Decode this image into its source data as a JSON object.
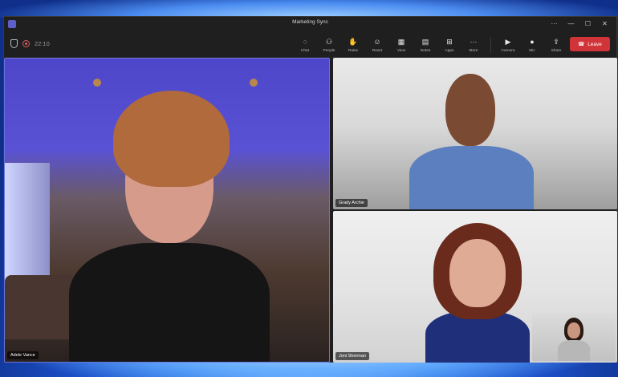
{
  "window": {
    "title": "Marketing Sync",
    "controls": [
      "···",
      "—",
      "☐",
      "✕"
    ]
  },
  "toolbar": {
    "timer": "22:10",
    "tools": [
      {
        "icon": "chat-icon",
        "glyph": "◌",
        "label": "Chat"
      },
      {
        "icon": "people-icon",
        "glyph": "⚇",
        "label": "People"
      },
      {
        "icon": "raise-hand-icon",
        "glyph": "✋",
        "label": "Raise"
      },
      {
        "icon": "react-icon",
        "glyph": "☺",
        "label": "React"
      },
      {
        "icon": "view-icon",
        "glyph": "▦",
        "label": "View"
      },
      {
        "icon": "notes-icon",
        "glyph": "▤",
        "label": "Notes"
      },
      {
        "icon": "apps-icon",
        "glyph": "⊞",
        "label": "Apps"
      },
      {
        "icon": "more-icon",
        "glyph": "···",
        "label": "More"
      }
    ],
    "media": [
      {
        "icon": "camera-icon",
        "glyph": "▶",
        "label": "Camera"
      },
      {
        "icon": "mic-icon",
        "glyph": "●",
        "label": "Mic"
      },
      {
        "icon": "share-icon",
        "glyph": "⇪",
        "label": "Share"
      }
    ],
    "leave_label": "Leave",
    "leave_color": "#d13438"
  },
  "participants": {
    "main": {
      "name": "Adele Vance"
    },
    "right_top": {
      "name": "Grady Archie"
    },
    "right_bottom": {
      "name": "Joni Sherman"
    }
  }
}
